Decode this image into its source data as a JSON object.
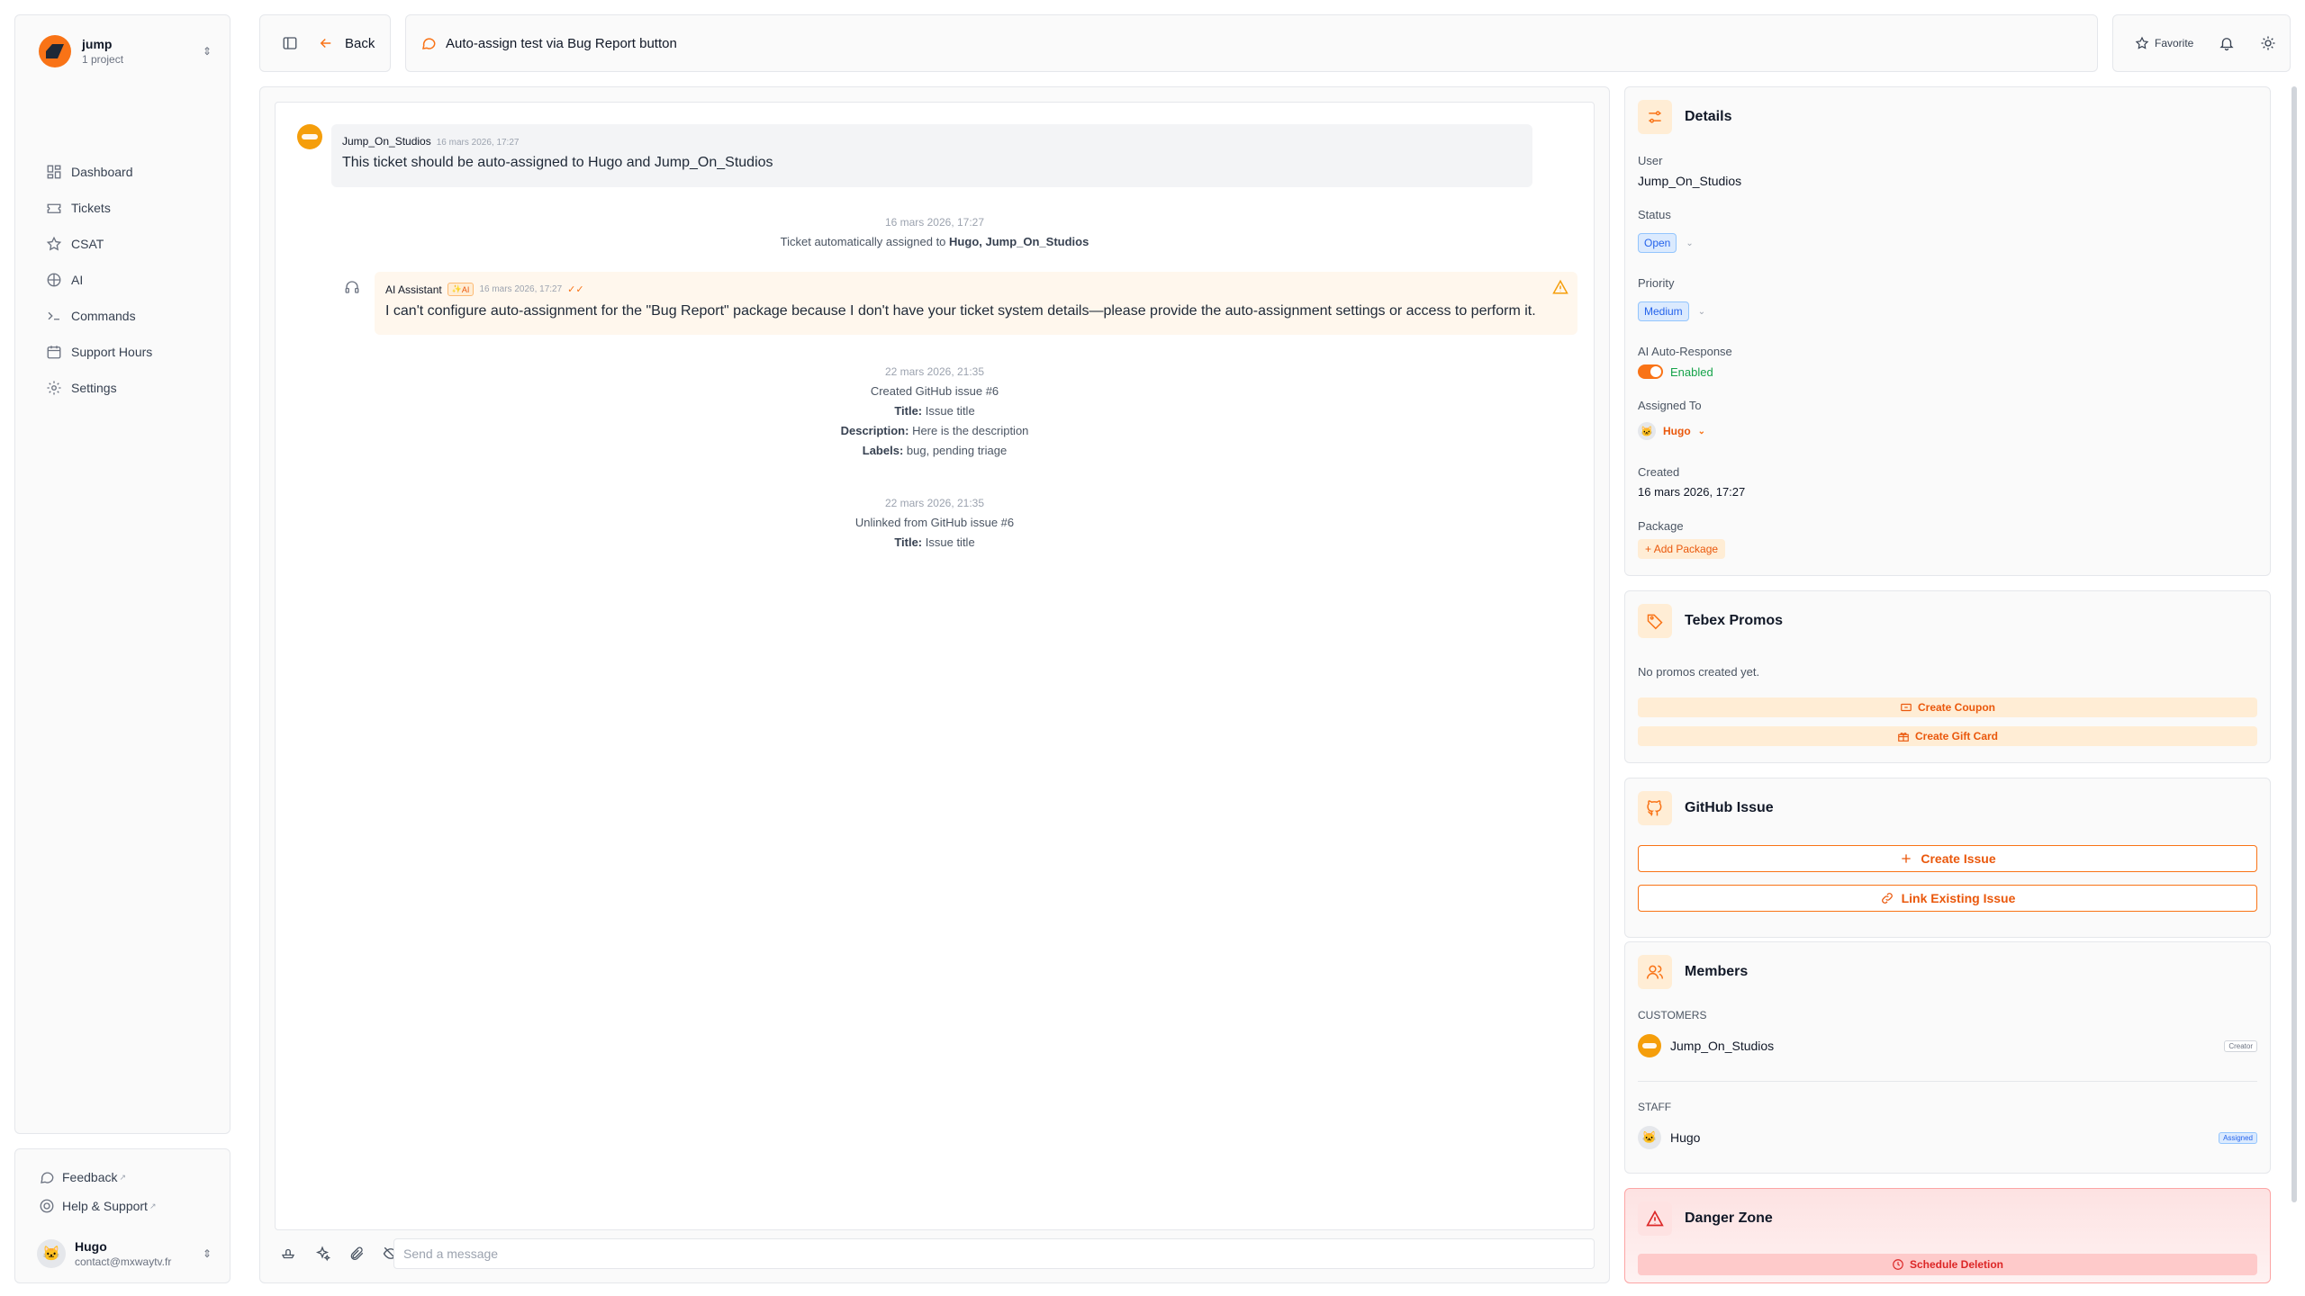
{
  "workspace": {
    "name": "jump",
    "subtitle": "1 project"
  },
  "nav": [
    {
      "label": "Dashboard",
      "icon": "dashboard-icon"
    },
    {
      "label": "Tickets",
      "icon": "ticket-icon"
    },
    {
      "label": "CSAT",
      "icon": "star-icon"
    },
    {
      "label": "AI",
      "icon": "ai-icon"
    },
    {
      "label": "Commands",
      "icon": "terminal-icon"
    },
    {
      "label": "Support Hours",
      "icon": "calendar-icon"
    },
    {
      "label": "Settings",
      "icon": "gear-icon"
    }
  ],
  "footer": {
    "feedback": "Feedback",
    "help": "Help & Support",
    "external_mark": "↗",
    "user_name": "Hugo",
    "user_email": "contact@mxwaytv.fr"
  },
  "topbar": {
    "back_label": "Back",
    "ticket_title": "Auto-assign test via Bug Report button",
    "favorite_label": "Favorite"
  },
  "messages": {
    "m1": {
      "author": "Jump_On_Studios",
      "time": "16 mars 2026, 17:27",
      "text": "This ticket should be auto-assigned to Hugo and Jump_On_Studios"
    },
    "sys1": {
      "time": "16 mars 2026, 17:27",
      "prefix": "Ticket automatically assigned to",
      "names": "Hugo, Jump_On_Studios"
    },
    "m2": {
      "author": "AI Assistant",
      "badge": "AI",
      "time": "16 mars 2026, 17:27",
      "text": "I can't configure auto-assignment for the \"Bug Report\" package because I don't have your ticket system details—please provide the auto-assignment settings or access to perform it."
    },
    "sys2": {
      "time": "22 mars 2026, 21:35",
      "line": "Created GitHub issue #6",
      "title_label": "Title:",
      "title_value": "Issue title",
      "desc_label": "Description:",
      "desc_value": "Here is the description",
      "labels_label": "Labels:",
      "labels_value": "bug, pending triage"
    },
    "sys3": {
      "time": "22 mars 2026, 21:35",
      "line": "Unlinked from GitHub issue #6",
      "title_label": "Title:",
      "title_value": "Issue title"
    }
  },
  "composer": {
    "placeholder": "Send a message"
  },
  "details": {
    "title": "Details",
    "user_label": "User",
    "user_value": "Jump_On_Studios",
    "status_label": "Status",
    "status_value": "Open",
    "priority_label": "Priority",
    "priority_value": "Medium",
    "ai_label": "AI Auto-Response",
    "ai_value": "Enabled",
    "assigned_label": "Assigned To",
    "assigned_value": "Hugo",
    "created_label": "Created",
    "created_value": "16 mars 2026, 17:27",
    "package_label": "Package",
    "add_package": "Add Package"
  },
  "tebex": {
    "title": "Tebex Promos",
    "empty": "No promos created yet.",
    "coupon": "Create Coupon",
    "gift": "Create Gift Card"
  },
  "github": {
    "title": "GitHub Issue",
    "create": "Create Issue",
    "link": "Link Existing Issue"
  },
  "members": {
    "title": "Members",
    "customers_label": "CUSTOMERS",
    "customer_name": "Jump_On_Studios",
    "customer_tag": "Creator",
    "staff_label": "STAFF",
    "staff_name": "Hugo",
    "staff_tag": "Assigned"
  },
  "danger": {
    "title": "Danger Zone",
    "schedule": "Schedule Deletion"
  },
  "colors": {
    "accent": "#f97316",
    "danger": "#dc2626",
    "success": "#16a34a",
    "info": "#2563eb"
  }
}
